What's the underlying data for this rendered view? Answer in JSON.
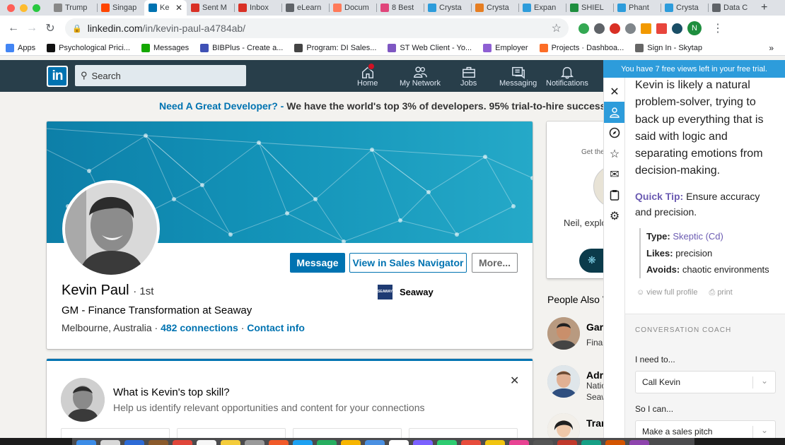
{
  "browser": {
    "tabs": [
      {
        "label": "Trump",
        "color": "#888888"
      },
      {
        "label": "Singap",
        "color": "#ff4500"
      },
      {
        "label": "Ke",
        "color": "#0073b1",
        "active": true
      },
      {
        "label": "Sent M",
        "color": "#d93025"
      },
      {
        "label": "Inbox",
        "color": "#d93025"
      },
      {
        "label": "eLearn",
        "color": "#5f6368"
      },
      {
        "label": "Docum",
        "color": "#ff7a59"
      },
      {
        "label": "8 Best",
        "color": "#e0457b"
      },
      {
        "label": "Crysta",
        "color": "#2d9cdb"
      },
      {
        "label": "Crysta",
        "color": "#e67e22"
      },
      {
        "label": "Expan",
        "color": "#2d9cdb"
      },
      {
        "label": "SHIEL",
        "color": "#1e8e3e"
      },
      {
        "label": "Phant",
        "color": "#2d9cdb"
      },
      {
        "label": "Crysta",
        "color": "#2d9cdb"
      },
      {
        "label": "Data C",
        "color": "#5f6368"
      }
    ],
    "url": {
      "host": "linkedin.com",
      "path": "/in/kevin-paul-a4784ab/"
    },
    "profile_initial": "N",
    "bookmarks": [
      {
        "label": "Apps",
        "color": "#4285f4"
      },
      {
        "label": "Psychological Prici...",
        "color": "#111111",
        "badge": "NK"
      },
      {
        "label": "Messages",
        "color": "#14a800",
        "badge": "Up"
      },
      {
        "label": "BIBPlus - Create a...",
        "color": "#3f51b5"
      },
      {
        "label": "Program: DI Sales...",
        "color": "#444444"
      },
      {
        "label": "ST Web Client - Yo...",
        "color": "#7e57c2"
      },
      {
        "label": "Employer",
        "color": "#8e5fd3"
      },
      {
        "label": "Projects · Dashboa...",
        "color": "#fc6d26"
      },
      {
        "label": "Sign In - Skytap",
        "color": "#666666"
      }
    ]
  },
  "linkedin_nav": {
    "search_placeholder": "Search",
    "items": [
      "Home",
      "My Network",
      "Jobs",
      "Messaging",
      "Notifications"
    ]
  },
  "ad": {
    "link": "Need A Great Developer? -",
    "text": " We have the world's top 3% of developers. 95% trial-to-hire success rate."
  },
  "profile": {
    "name": "Kevin Paul",
    "degree": "· 1st",
    "headline": "GM - Finance Transformation at Seaway",
    "location": "Melbourne, Australia",
    "connections": "482 connections",
    "contact": "Contact info",
    "company": "Seaway",
    "company_logo_text": "SEAWAY",
    "buttons": {
      "message": "Message",
      "sales_nav": "View in Sales Navigator",
      "more": "More..."
    }
  },
  "skill_prompt": {
    "question": "What is Kevin's top skill?",
    "subtitle": "Help us identify relevant opportunities and content for your connections"
  },
  "right_column": {
    "getthe": "Get the",
    "neil": "Neil, explo",
    "people_also_viewed": "People Also V",
    "people": [
      {
        "name": "Gar",
        "line1": "Finar",
        "line2": ""
      },
      {
        "name": "Adri",
        "line1": "Natio",
        "line2": "Seaw"
      },
      {
        "name": "Tran",
        "line1": "",
        "line2": ""
      }
    ]
  },
  "crystal": {
    "banner": "You have 7 free views left in your free trial.",
    "description": "Kevin is likely a natural problem-solver, trying to back up everything that is said with logic and separating emotions from decision-making.",
    "quick_tip_label": "Quick Tip:",
    "quick_tip_text": " Ensure accuracy and precision.",
    "type_label": "Type:",
    "type_value": "Skeptic (Cd)",
    "likes_label": "Likes:",
    "likes_value": "precision",
    "avoids_label": "Avoids:",
    "avoids_value": "chaotic environments",
    "view_full_profile": "view full profile",
    "print": "print",
    "coach_title": "CONVERSATION COACH",
    "need_label": "I need to...",
    "need_value": "Call Kevin",
    "can_label": "So I can...",
    "can_value": "Make a sales pitch"
  },
  "colors": {
    "linkedin_blue": "#0073b1",
    "header": "#283e4a",
    "crystal_blue": "#2d9cdb",
    "crystal_purple": "#6b5bb2"
  }
}
